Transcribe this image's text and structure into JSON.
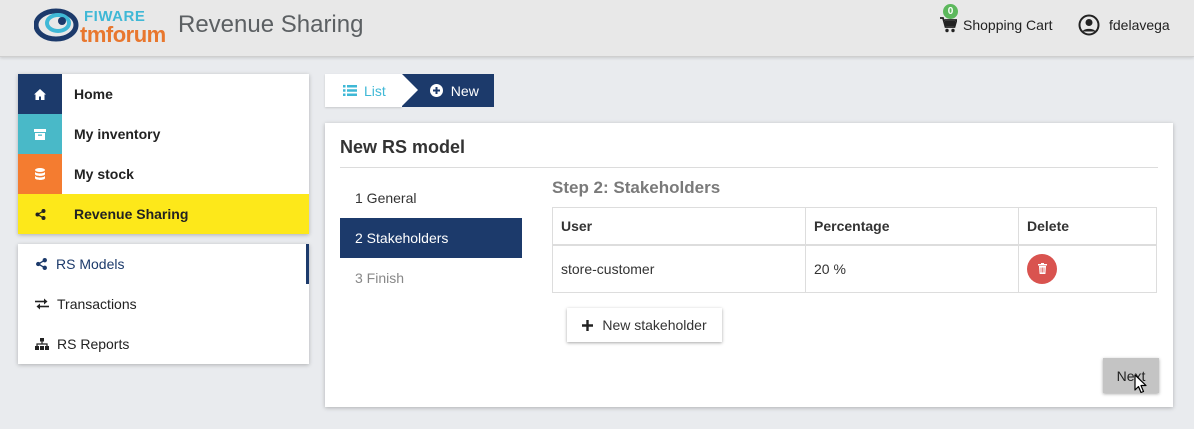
{
  "header": {
    "logo_top": "FIWARE",
    "logo_bottom": "tmforum",
    "app_title": "Revenue Sharing",
    "cart_count": "0",
    "cart_label": "Shopping Cart",
    "username": "fdelavega"
  },
  "colors": {
    "navy": "#1c3a6b",
    "teal": "#49b9c8",
    "orange": "#f47c30",
    "yellow": "#fde81a",
    "danger": "#d9534f",
    "success": "#5cb85c"
  },
  "nav": {
    "items": [
      {
        "label": "Home",
        "icon": "home-icon"
      },
      {
        "label": "My inventory",
        "icon": "archive-icon"
      },
      {
        "label": "My stock",
        "icon": "database-icon"
      },
      {
        "label": "Revenue Sharing",
        "icon": "share-icon"
      }
    ]
  },
  "subnav": {
    "items": [
      {
        "label": "RS Models",
        "icon": "share-icon"
      },
      {
        "label": "Transactions",
        "icon": "exchange-icon"
      },
      {
        "label": "RS Reports",
        "icon": "sitemap-icon"
      }
    ]
  },
  "breadcrumb": {
    "list_label": "List",
    "new_label": "New"
  },
  "panel": {
    "title": "New RS model",
    "steps": [
      "1 General",
      "2 Stakeholders",
      "3 Finish"
    ],
    "step_heading": "Step 2: Stakeholders",
    "table": {
      "headers": [
        "User",
        "Percentage",
        "Delete"
      ],
      "rows": [
        {
          "user": "store-customer",
          "percentage": "20 %"
        }
      ]
    },
    "add_label": "New stakeholder",
    "next_label": "Next"
  }
}
